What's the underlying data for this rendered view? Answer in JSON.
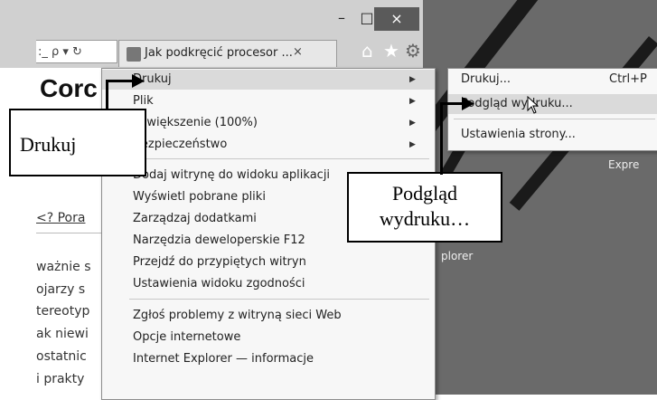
{
  "window": {
    "minimize_glyph": "–",
    "maximize_glyph": "□",
    "close_glyph": "×"
  },
  "address_bar": {
    "text": ":_ ρ ▾ ↻"
  },
  "tab": {
    "title": "Jak podkręcić procesor ...",
    "close_glyph": "×"
  },
  "toolbar": {
    "home_glyph": "⌂",
    "star_glyph": "★",
    "gear_glyph": "⚙"
  },
  "page": {
    "heading": "Corc",
    "link": "<? Pora",
    "lines": [
      "ważnie s",
      "ojarzy s",
      "tereotyp",
      "ak niewi",
      "ostatnic",
      "i prakty"
    ],
    "right_text_1": "Expre",
    "right_text_2": "plorer"
  },
  "main_menu": {
    "items": [
      {
        "label": "Drukuj",
        "has_submenu": true,
        "highlighted": true
      },
      {
        "label": "Plik",
        "has_submenu": true
      },
      {
        "label": "Powiększenie (100%)",
        "has_submenu": true
      },
      {
        "label": "Bezpieczeństwo",
        "has_submenu": true
      },
      {
        "label": "Dodaj witrynę do widoku aplikacji"
      },
      {
        "label": "Wyświetl pobrane pliki"
      },
      {
        "label": "Zarządzaj dodatkami"
      },
      {
        "label": "Narzędzia deweloperskie F12"
      },
      {
        "label": "Przejdź do przypiętych witryn"
      },
      {
        "label": "Ustawienia widoku zgodności"
      },
      {
        "label": "Zgłoś problemy z witryną sieci Web"
      },
      {
        "label": "Opcje internetowe"
      },
      {
        "label": "Internet Explorer — informacje"
      }
    ]
  },
  "sub_menu": {
    "items": [
      {
        "label": "Drukuj...",
        "shortcut": "Ctrl+P"
      },
      {
        "label": "Podgląd wydruku...",
        "highlighted": true
      },
      {
        "label": "Ustawienia strony..."
      }
    ]
  },
  "callouts": {
    "print": "Drukuj",
    "preview": "Podgląd wydruku…"
  }
}
